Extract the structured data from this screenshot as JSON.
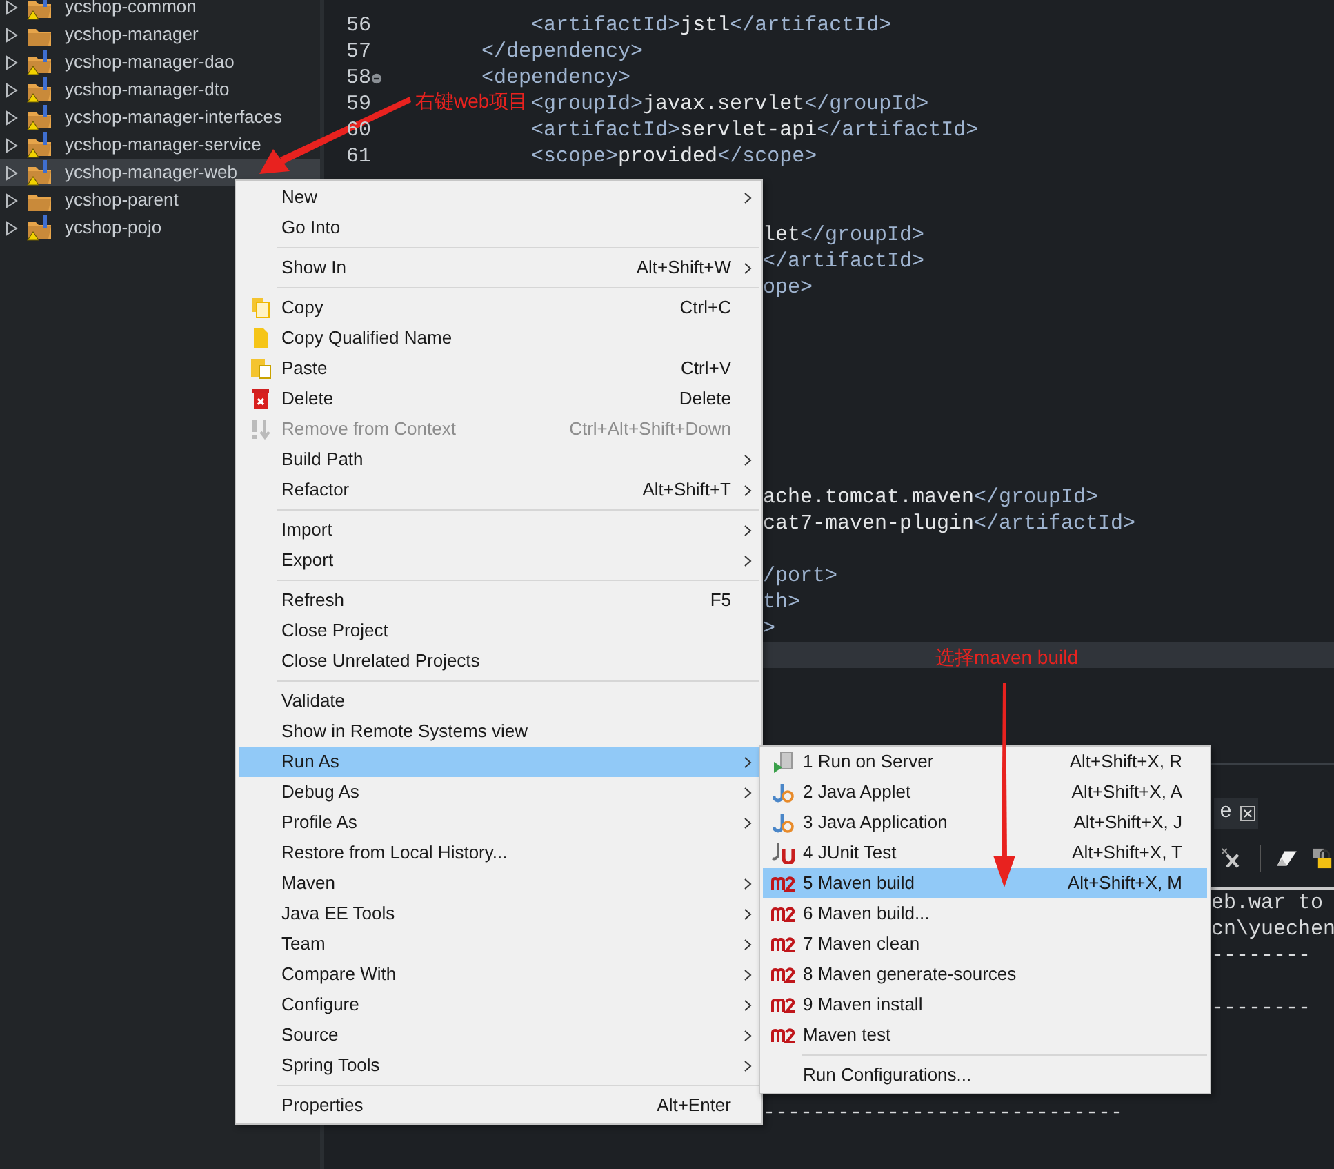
{
  "project_explorer": {
    "items": [
      {
        "label": "ycshop-common",
        "kind": "java",
        "selected": false
      },
      {
        "label": "ycshop-manager",
        "kind": "pom",
        "selected": false
      },
      {
        "label": "ycshop-manager-dao",
        "kind": "java",
        "selected": false
      },
      {
        "label": "ycshop-manager-dto",
        "kind": "java",
        "selected": false
      },
      {
        "label": "ycshop-manager-interfaces",
        "kind": "java",
        "selected": false
      },
      {
        "label": "ycshop-manager-service",
        "kind": "java",
        "selected": false
      },
      {
        "label": "ycshop-manager-web",
        "kind": "java",
        "selected": true
      },
      {
        "label": "ycshop-parent",
        "kind": "pom",
        "selected": false
      },
      {
        "label": "ycshop-pojo",
        "kind": "java",
        "selected": false
      }
    ]
  },
  "editor": {
    "lines": [
      {
        "kind": "code",
        "number": "56",
        "text": "            <artifactId>jstl</artifactId>"
      },
      {
        "kind": "code",
        "number": "57",
        "text": "        </dependency>"
      },
      {
        "kind": "code",
        "number": "58",
        "text": "        <dependency>",
        "fold_expanded": true
      },
      {
        "kind": "code",
        "number": "59",
        "text": "            <groupId>javax.servlet</groupId>"
      },
      {
        "kind": "code",
        "number": "60",
        "text": "            <artifactId>servlet-api</artifactId>"
      },
      {
        "kind": "code",
        "number": "61",
        "text": "            <scope>provided</scope>"
      },
      {
        "kind": "blank"
      },
      {
        "kind": "blank"
      },
      {
        "kind": "covered",
        "text": "let</groupId>"
      },
      {
        "kind": "covered",
        "text": "</artifactId>"
      },
      {
        "kind": "covered",
        "text": "ope>"
      },
      {
        "kind": "blank"
      },
      {
        "kind": "blank"
      },
      {
        "kind": "blank"
      },
      {
        "kind": "blank"
      },
      {
        "kind": "blank"
      },
      {
        "kind": "blank"
      },
      {
        "kind": "blank"
      },
      {
        "kind": "covered",
        "text": "ache.tomcat.maven</groupId>"
      },
      {
        "kind": "covered",
        "text": "cat7-maven-plugin</artifactId>"
      },
      {
        "kind": "blank"
      },
      {
        "kind": "covered",
        "text": "/port>"
      },
      {
        "kind": "covered",
        "text": "th>"
      },
      {
        "kind": "covered",
        "text": ">"
      },
      {
        "kind": "current"
      }
    ]
  },
  "console": {
    "tab": {
      "label": "e"
    },
    "lines": [
      {
        "kind": "right",
        "text": "eb.war to"
      },
      {
        "kind": "right",
        "text": "cn\\yuechen"
      },
      {
        "kind": "right",
        "text": "--------"
      },
      {
        "kind": "blank"
      },
      {
        "kind": "right",
        "text": "--------"
      },
      {
        "kind": "blank"
      },
      {
        "kind": "blank"
      },
      {
        "kind": "blank"
      },
      {
        "kind": "below",
        "text": "-----------------------------"
      }
    ]
  },
  "context_menu": {
    "items": [
      {
        "kind": "item",
        "label": "New",
        "submenu": true,
        "disabled": false,
        "selected": false
      },
      {
        "kind": "item",
        "label": "Go Into",
        "submenu": false,
        "disabled": false,
        "selected": false
      },
      {
        "kind": "separator"
      },
      {
        "kind": "item",
        "label": "Show In",
        "shortcut": "Alt+Shift+W",
        "submenu": true,
        "disabled": false,
        "selected": false
      },
      {
        "kind": "separator"
      },
      {
        "kind": "item",
        "label": "Copy",
        "shortcut": "Ctrl+C",
        "submenu": false,
        "disabled": false,
        "selected": false
      },
      {
        "kind": "item",
        "label": "Copy Qualified Name",
        "submenu": false,
        "disabled": false,
        "selected": false
      },
      {
        "kind": "item",
        "label": "Paste",
        "shortcut": "Ctrl+V",
        "submenu": false,
        "disabled": false,
        "selected": false
      },
      {
        "kind": "item",
        "label": "Delete",
        "shortcut": "Delete",
        "submenu": false,
        "disabled": false,
        "selected": false
      },
      {
        "kind": "item",
        "label": "Remove from Context",
        "shortcut": "Ctrl+Alt+Shift+Down",
        "submenu": false,
        "disabled": true,
        "selected": false
      },
      {
        "kind": "item",
        "label": "Build Path",
        "submenu": true,
        "disabled": false,
        "selected": false
      },
      {
        "kind": "item",
        "label": "Refactor",
        "shortcut": "Alt+Shift+T",
        "submenu": true,
        "disabled": false,
        "selected": false
      },
      {
        "kind": "separator"
      },
      {
        "kind": "item",
        "label": "Import",
        "submenu": true,
        "disabled": false,
        "selected": false
      },
      {
        "kind": "item",
        "label": "Export",
        "submenu": true,
        "disabled": false,
        "selected": false
      },
      {
        "kind": "separator"
      },
      {
        "kind": "item",
        "label": "Refresh",
        "shortcut": "F5",
        "submenu": false,
        "disabled": false,
        "selected": false
      },
      {
        "kind": "item",
        "label": "Close Project",
        "submenu": false,
        "disabled": false,
        "selected": false
      },
      {
        "kind": "item",
        "label": "Close Unrelated Projects",
        "submenu": false,
        "disabled": false,
        "selected": false
      },
      {
        "kind": "separator"
      },
      {
        "kind": "item",
        "label": "Validate",
        "submenu": false,
        "disabled": false,
        "selected": false
      },
      {
        "kind": "item",
        "label": "Show in Remote Systems view",
        "submenu": false,
        "disabled": false,
        "selected": false
      },
      {
        "kind": "item",
        "label": "Run As",
        "submenu": true,
        "disabled": false,
        "selected": true
      },
      {
        "kind": "item",
        "label": "Debug As",
        "submenu": true,
        "disabled": false,
        "selected": false
      },
      {
        "kind": "item",
        "label": "Profile As",
        "submenu": true,
        "disabled": false,
        "selected": false
      },
      {
        "kind": "item",
        "label": "Restore from Local History...",
        "submenu": false,
        "disabled": false,
        "selected": false
      },
      {
        "kind": "item",
        "label": "Maven",
        "submenu": true,
        "disabled": false,
        "selected": false
      },
      {
        "kind": "item",
        "label": "Java EE Tools",
        "submenu": true,
        "disabled": false,
        "selected": false
      },
      {
        "kind": "item",
        "label": "Team",
        "submenu": true,
        "disabled": false,
        "selected": false
      },
      {
        "kind": "item",
        "label": "Compare With",
        "submenu": true,
        "disabled": false,
        "selected": false
      },
      {
        "kind": "item",
        "label": "Configure",
        "submenu": true,
        "disabled": false,
        "selected": false
      },
      {
        "kind": "item",
        "label": "Source",
        "submenu": true,
        "disabled": false,
        "selected": false
      },
      {
        "kind": "item",
        "label": "Spring Tools",
        "submenu": true,
        "disabled": false,
        "selected": false
      },
      {
        "kind": "separator"
      },
      {
        "kind": "item",
        "label": "Properties",
        "shortcut": "Alt+Enter",
        "submenu": false,
        "disabled": false,
        "selected": false
      }
    ]
  },
  "run_as_submenu": {
    "items": [
      {
        "kind": "item",
        "label": "1 Run on Server",
        "shortcut": "Alt+Shift+X, R",
        "selected": false
      },
      {
        "kind": "item",
        "label": "2 Java Applet",
        "shortcut": "Alt+Shift+X, A",
        "selected": false
      },
      {
        "kind": "item",
        "label": "3 Java Application",
        "shortcut": "Alt+Shift+X, J",
        "selected": false
      },
      {
        "kind": "item",
        "label": "4 JUnit Test",
        "shortcut": "Alt+Shift+X, T",
        "selected": false
      },
      {
        "kind": "item",
        "label": "5 Maven build",
        "shortcut": "Alt+Shift+X, M",
        "selected": true
      },
      {
        "kind": "item",
        "label": "6 Maven build...",
        "selected": false
      },
      {
        "kind": "item",
        "label": "7 Maven clean",
        "selected": false
      },
      {
        "kind": "item",
        "label": "8 Maven generate-sources",
        "selected": false
      },
      {
        "kind": "item",
        "label": "9 Maven install",
        "selected": false
      },
      {
        "kind": "item",
        "label": "Maven test",
        "selected": false
      },
      {
        "kind": "separator"
      },
      {
        "kind": "item",
        "label": "Run Configurations...",
        "selected": false
      }
    ]
  },
  "annotations": [
    {
      "text": "右键web项目"
    },
    {
      "text": "选择maven build"
    }
  ]
}
